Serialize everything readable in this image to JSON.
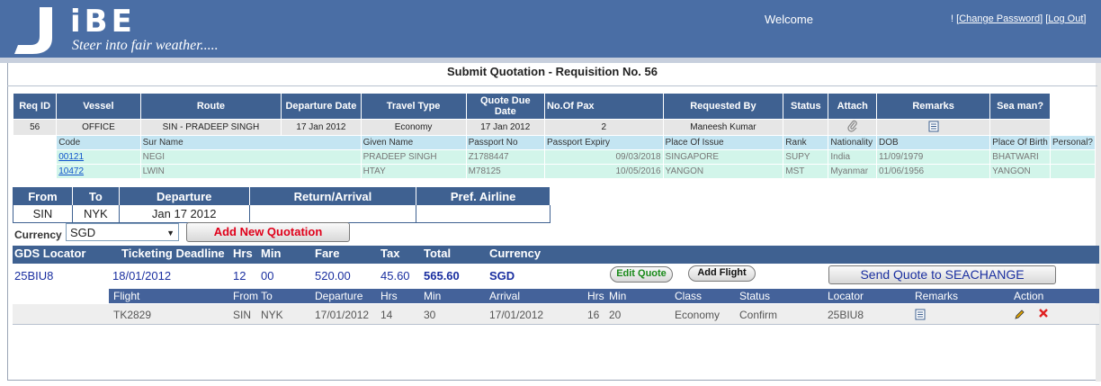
{
  "header": {
    "logo_letters": "iBE",
    "tagline": "Steer into fair weather.....",
    "welcome": "Welcome",
    "bang": "!",
    "change_password": "Change Password",
    "log_out": "Log Out",
    "bg_color": "#4a6ea5"
  },
  "page_title": "Submit Quotation - Requisition No. 56",
  "requisition": {
    "columns": [
      "Req ID",
      "Vessel",
      "Route",
      "Departure Date",
      "Travel Type",
      "Quote Due Date",
      "No.Of Pax",
      "Requested By",
      "Status",
      "Attach",
      "Remarks",
      "Sea man?"
    ],
    "row": {
      "req_id": "56",
      "vessel": "OFFICE",
      "route": "SIN - PRADEEP SINGH",
      "departure_date": "17 Jan 2012",
      "travel_type": "Economy",
      "quote_due_date": "17 Jan 2012",
      "pax": "2",
      "requested_by": "Maneesh Kumar",
      "status": "",
      "attach_icon": "paperclip-icon",
      "remarks_icon": "note-icon"
    },
    "crew_columns": [
      "Code",
      "Sur Name",
      "Given Name",
      "Passport No",
      "Passport Expiry",
      "Place Of Issue",
      "Rank",
      "Nationality",
      "DOB",
      "Place Of Birth",
      "Personal?"
    ],
    "crew": [
      {
        "code": "00121",
        "sur_name": "NEGI",
        "given_name": "PRADEEP SINGH",
        "passport_no": "Z1788447",
        "passport_expiry": "09/03/2018",
        "place_of_issue": "SINGAPORE",
        "rank": "SUPY",
        "nationality": "India",
        "dob": "11/09/1979",
        "place_of_birth": "BHATWARI",
        "personal": ""
      },
      {
        "code": "10472",
        "sur_name": "LWIN",
        "given_name": "HTAY",
        "passport_no": "M78125",
        "passport_expiry": "10/05/2016",
        "place_of_issue": "YANGON",
        "rank": "MST",
        "nationality": "Myanmar",
        "dob": "01/06/1956",
        "place_of_birth": "YANGON",
        "personal": ""
      }
    ]
  },
  "route_table": {
    "columns": [
      "From",
      "To",
      "Departure",
      "Return/Arrival",
      "Pref. Airline"
    ],
    "row": {
      "from": "SIN",
      "to": "NYK",
      "departure": "Jan 17 2012",
      "return_arrival": "",
      "pref_airline": ""
    }
  },
  "currency": {
    "label": "Currency",
    "selected": "SGD"
  },
  "add_quotation_label": "Add New Quotation",
  "quote": {
    "headers": {
      "gds": "GDS Locator",
      "deadline": "Ticketing Deadline",
      "hrs": "Hrs",
      "min": "Min",
      "fare": "Fare",
      "tax": "Tax",
      "total": "Total",
      "currency": "Currency"
    },
    "values": {
      "gds": "25BIU8",
      "deadline": "18/01/2012",
      "hrs": "12",
      "min": "00",
      "fare": "520.00",
      "tax": "45.60",
      "total": "565.60",
      "currency": "SGD"
    },
    "edit_label": "Edit Quote",
    "add_flight_label": "Add Flight",
    "send_label": "Send Quote to SEACHANGE"
  },
  "flight": {
    "headers": {
      "flight": "Flight",
      "from_to": "From To",
      "departure": "Departure",
      "hrs": "Hrs",
      "min": "Min",
      "arrival": "Arrival",
      "hrs2": "Hrs",
      "min2": "Min",
      "class": "Class",
      "status": "Status",
      "locator": "Locator",
      "remarks": "Remarks",
      "action": "Action"
    },
    "row": {
      "flight": "TK2829",
      "from": "SIN",
      "to": "NYK",
      "departure": "17/01/2012",
      "hrs": "14",
      "min": "30",
      "arrival": "17/01/2012",
      "hrs2": "16",
      "min2": "20",
      "class": "Economy",
      "status": "Confirm",
      "locator": "25BIU8"
    }
  }
}
